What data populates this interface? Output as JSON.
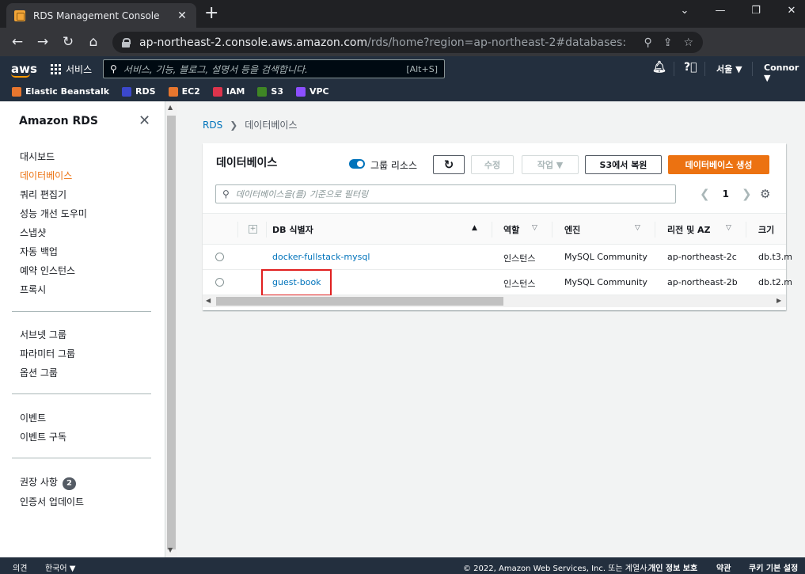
{
  "browser": {
    "tab_title": "RDS Management Console",
    "url_host": "ap-northeast-2.console.aws.amazon.com",
    "url_path": "/rds/home?region=ap-northeast-2#databases:"
  },
  "aws_header": {
    "logo": "aws",
    "services_label": "서비스",
    "search_placeholder": "서비스, 기능, 블로그, 설명서 등을 검색합니다.",
    "search_shortcut": "[Alt+S]",
    "region": "서울 ▼",
    "user": "Connor ▼"
  },
  "favorites": [
    {
      "label": "Elastic Beanstalk",
      "color": "#e7762e"
    },
    {
      "label": "RDS",
      "color": "#3b48cc"
    },
    {
      "label": "EC2",
      "color": "#e7762e"
    },
    {
      "label": "IAM",
      "color": "#dd344c"
    },
    {
      "label": "S3",
      "color": "#3f8624"
    },
    {
      "label": "VPC",
      "color": "#8c4fff"
    }
  ],
  "sidebar": {
    "title": "Amazon RDS",
    "group1": [
      "대시보드",
      "데이터베이스",
      "쿼리 편집기",
      "성능 개선 도우미",
      "스냅샷",
      "자동 백업",
      "예약 인스턴스",
      "프록시"
    ],
    "group2": [
      "서브넷 그룹",
      "파라미터 그룹",
      "옵션 그룹"
    ],
    "group3": [
      "이벤트",
      "이벤트 구독"
    ],
    "group4": [
      "권장 사항",
      "인증서 업데이트"
    ],
    "recommendations_count": "2"
  },
  "breadcrumb": {
    "root": "RDS",
    "current": "데이터베이스"
  },
  "panel": {
    "title": "데이터베이스",
    "toggle_label": "그룹 리소스",
    "modify_label": "수정",
    "actions_label": "작업 ▼",
    "restore_label": "S3에서 복원",
    "create_label": "데이터베이스 생성",
    "filter_placeholder": "데이터베이스을(를) 기준으로 필터링",
    "page": "1"
  },
  "table": {
    "headers": {
      "db_id": "DB 식별자",
      "role": "역할",
      "engine": "엔진",
      "region_az": "리전 및 AZ",
      "size": "크기"
    },
    "rows": [
      {
        "db_id": "docker-fullstack-mysql",
        "role": "인스턴스",
        "engine": "MySQL Community",
        "region_az": "ap-northeast-2c",
        "size": "db.t3.m"
      },
      {
        "db_id": "guest-book",
        "role": "인스턴스",
        "engine": "MySQL Community",
        "region_az": "ap-northeast-2b",
        "size": "db.t2.m"
      }
    ]
  },
  "footer": {
    "feedback": "의견",
    "language": "한국어 ▼",
    "copyright": "© 2022, Amazon Web Services, Inc. 또는 계열사.",
    "privacy": "개인 정보 보호",
    "terms": "약관",
    "cookies": "쿠키 기본 설정"
  }
}
